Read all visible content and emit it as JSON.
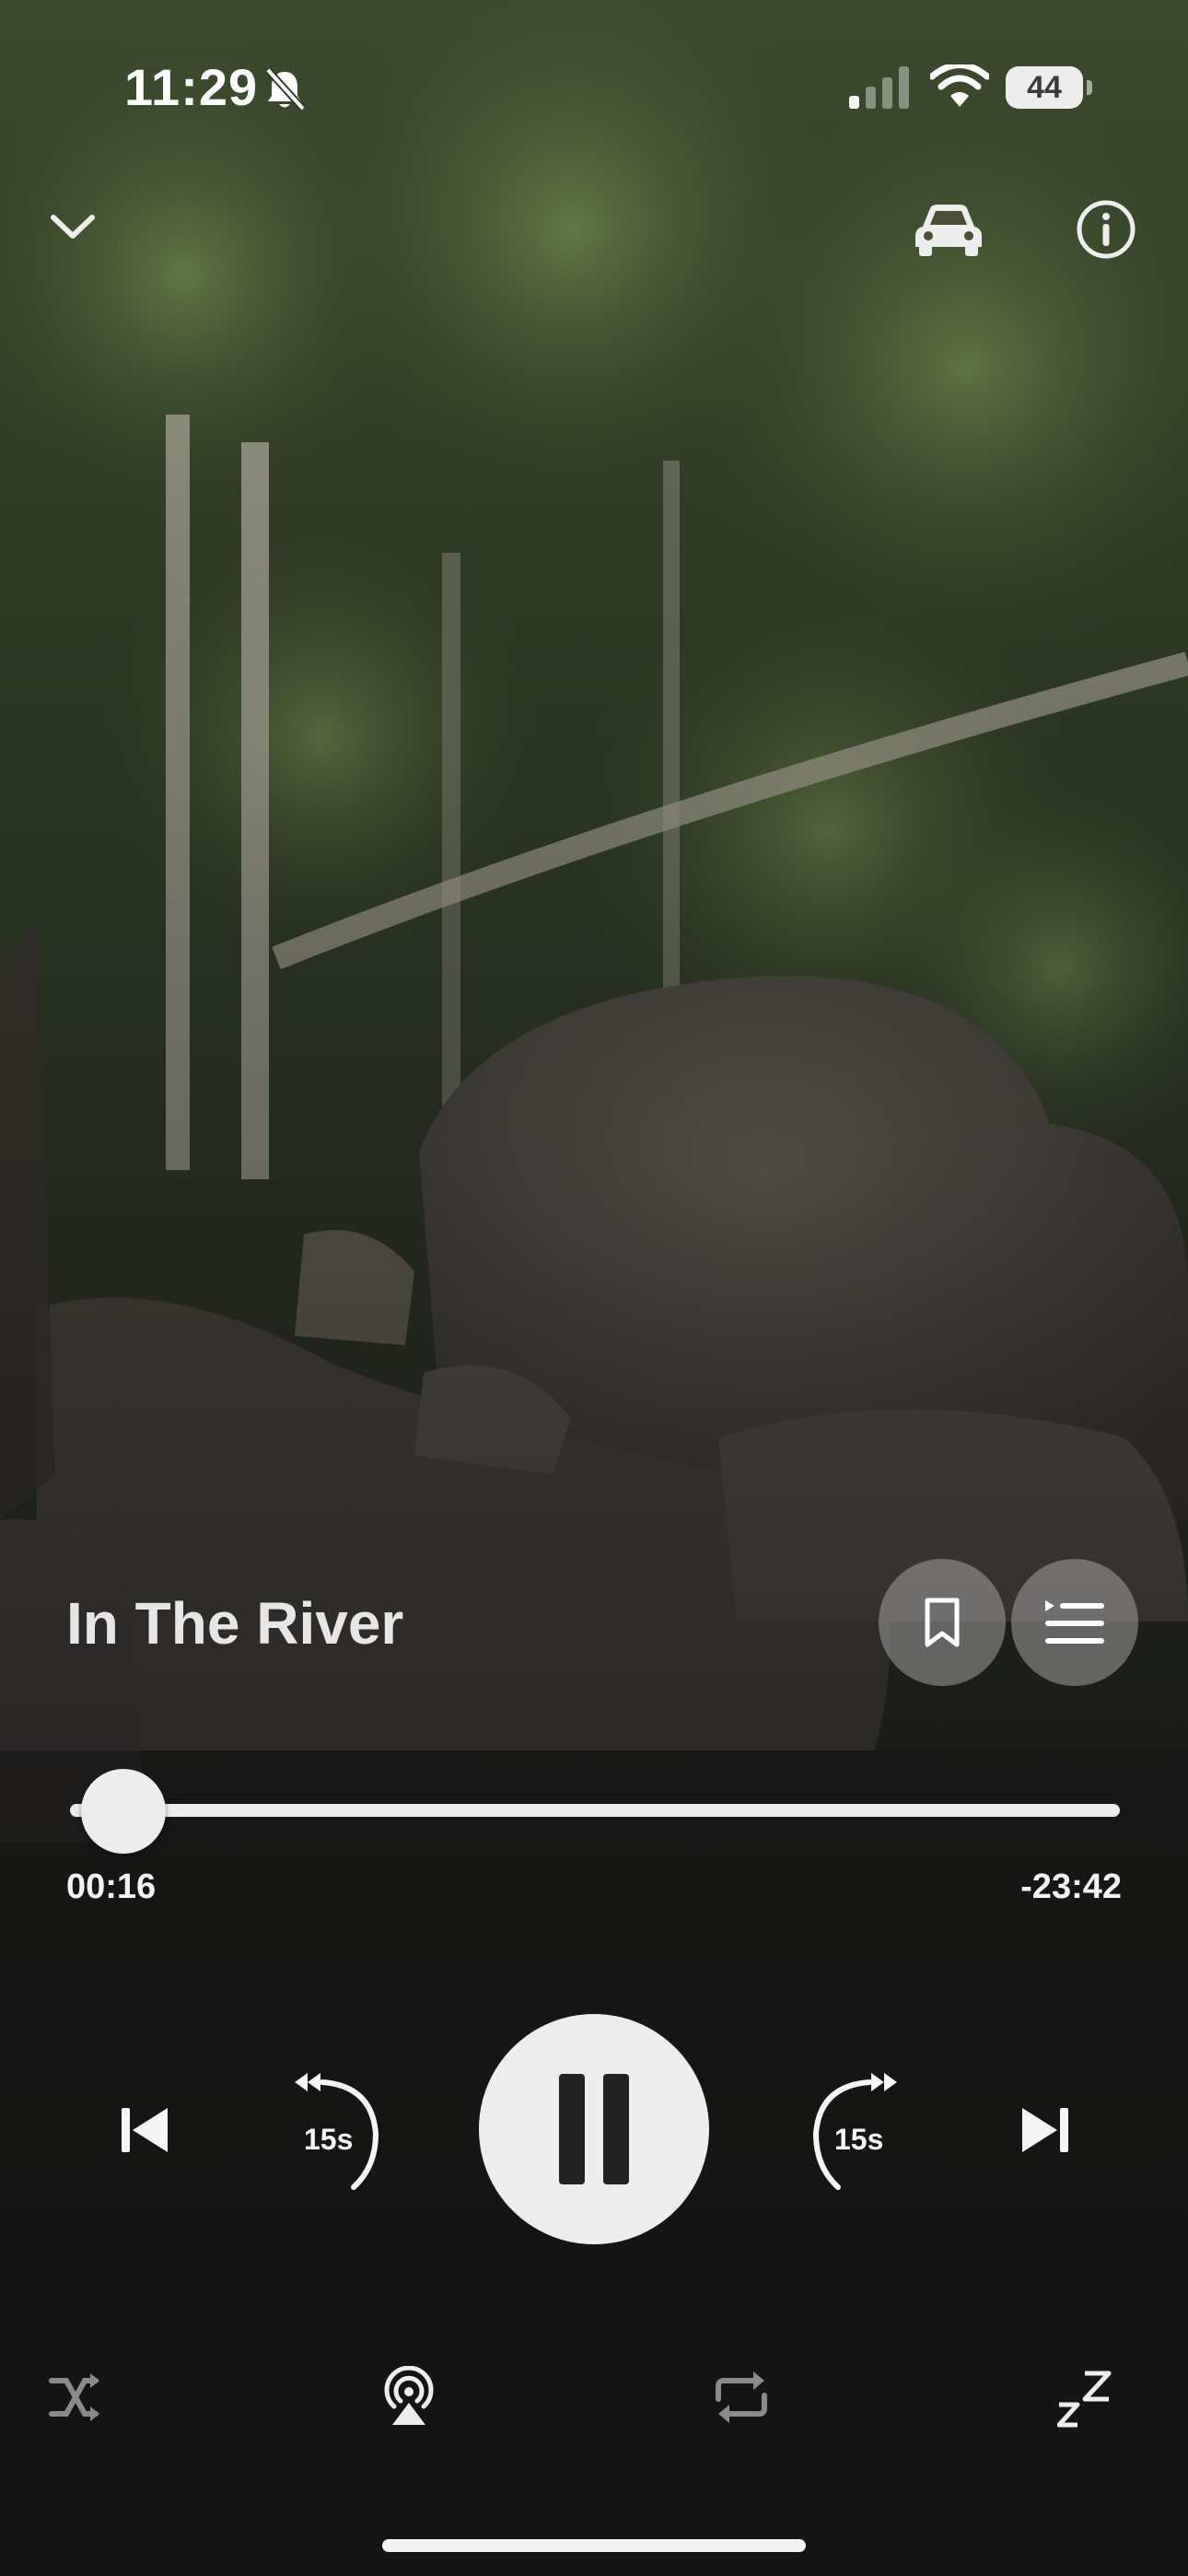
{
  "status_bar": {
    "time": "11:29",
    "battery": "44",
    "silent": true
  },
  "header": {
    "collapse_icon": "chevron-down-icon",
    "car_mode_icon": "car-icon",
    "info_icon": "info-icon"
  },
  "track": {
    "title": "In The River"
  },
  "actions": {
    "bookmark_icon": "bookmark-icon",
    "queue_icon": "queue-list-icon"
  },
  "progress": {
    "elapsed": "00:16",
    "remaining": "-23:42",
    "fraction": 0.011
  },
  "controls": {
    "rewind_label": "15s",
    "forward_label": "15s",
    "state": "playing"
  },
  "bottom_bar": [
    "shuffle-icon",
    "airplay-icon",
    "repeat-icon",
    "sleep-timer-icon"
  ],
  "colors": {
    "accent": "#ededed",
    "muted_icon": "#8a8a8a",
    "button_fill": "#a0a0a0"
  }
}
